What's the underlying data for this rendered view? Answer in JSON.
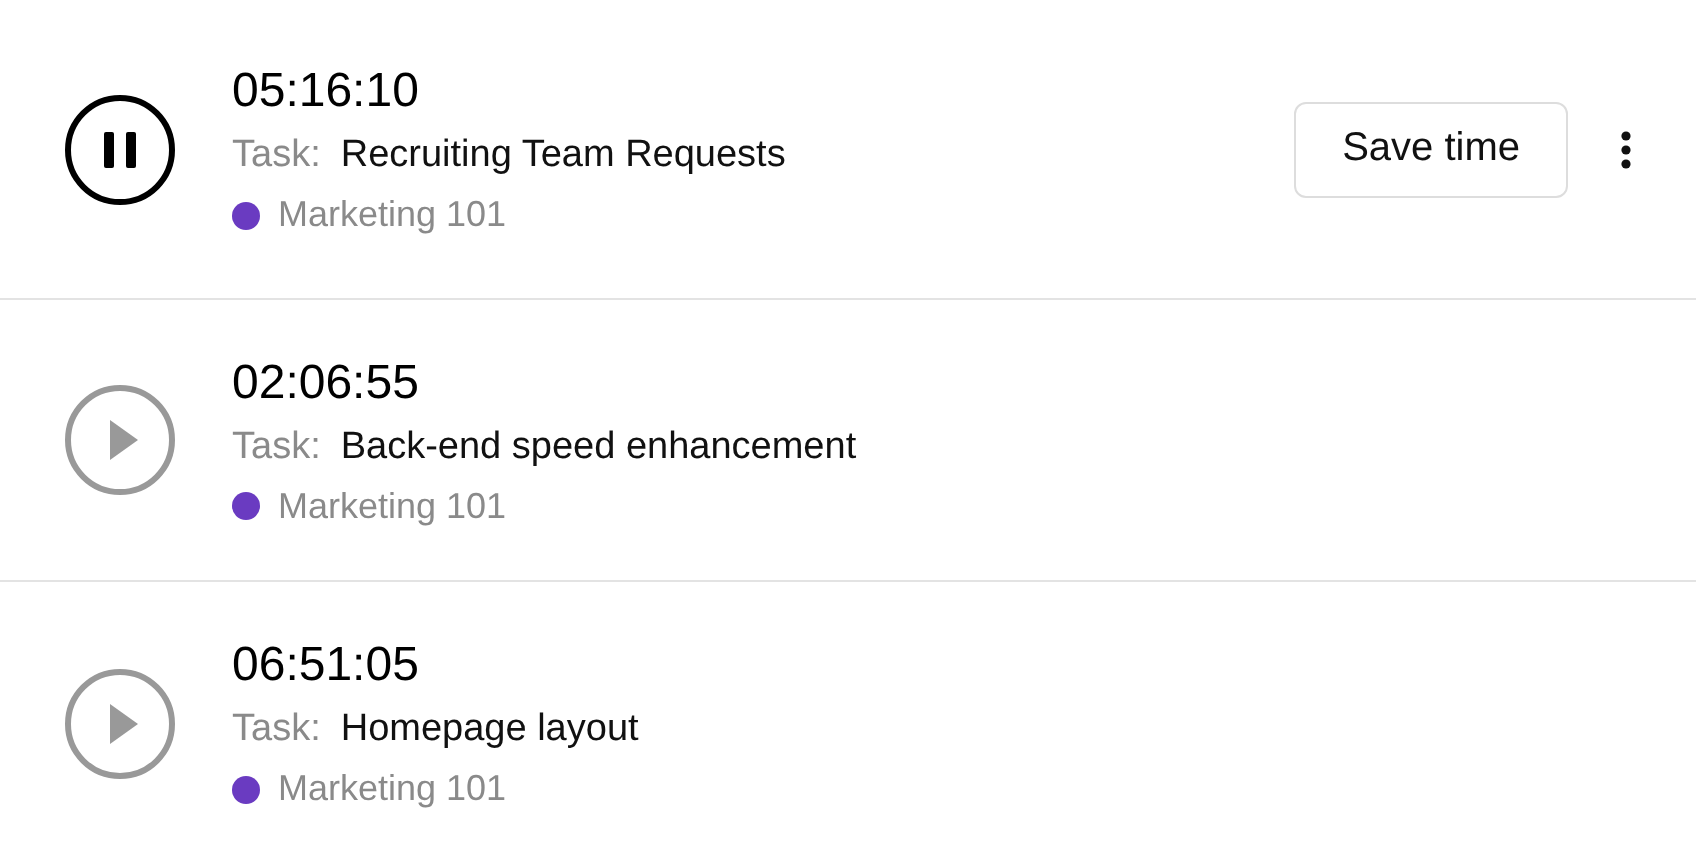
{
  "timers": [
    {
      "time": "05:16:10",
      "task_label": "Task:",
      "task": "Recruiting Team Requests",
      "project": "Marketing 101",
      "color": "#6a3bc1",
      "running": true,
      "save_button": "Save time"
    },
    {
      "time": "02:06:55",
      "task_label": "Task:",
      "task": "Back-end speed enhancement",
      "project": "Marketing 101",
      "color": "#6a3bc1",
      "running": false
    },
    {
      "time": "06:51:05",
      "task_label": "Task:",
      "task": "Homepage layout",
      "project": "Marketing 101",
      "color": "#6a3bc1",
      "running": false
    }
  ]
}
